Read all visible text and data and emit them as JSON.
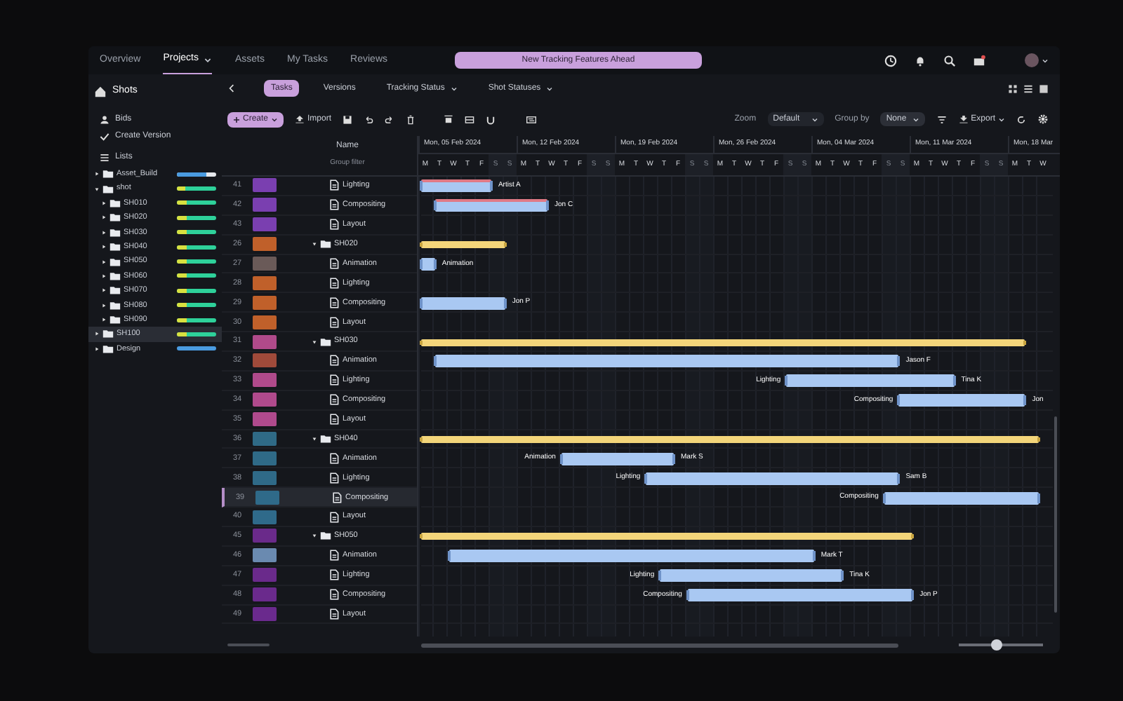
{
  "nav": {
    "items": [
      {
        "label": "Overview",
        "selected": false,
        "caret": false
      },
      {
        "label": "Projects",
        "selected": true,
        "caret": true
      },
      {
        "label": "Assets",
        "selected": false,
        "caret": false
      },
      {
        "label": "My Tasks",
        "selected": false,
        "caret": false
      },
      {
        "label": "Reviews",
        "selected": false,
        "caret": false
      }
    ],
    "banner": "New Tracking Features Ahead"
  },
  "sidebar": {
    "title": "Shots",
    "actions": [
      "Bids",
      "Create Version"
    ],
    "list_label": "Lists",
    "tree": [
      {
        "label": "Asset_Build",
        "level": 0.75,
        "kind": "plain",
        "selected": false,
        "expanded": false
      },
      {
        "label": "shot",
        "level": 0.2,
        "kind": "progress",
        "selected": false,
        "expanded": true,
        "children": [
          {
            "label": "SH010",
            "level": 0.25,
            "kind": "progress",
            "selected": false
          },
          {
            "label": "SH020",
            "level": 0.25,
            "kind": "progress",
            "selected": false
          },
          {
            "label": "SH030",
            "level": 0.25,
            "kind": "progress",
            "selected": false
          },
          {
            "label": "SH040",
            "level": 0.25,
            "kind": "progress",
            "selected": false
          },
          {
            "label": "SH050",
            "level": 0.25,
            "kind": "progress",
            "selected": false
          },
          {
            "label": "SH060",
            "level": 0.25,
            "kind": "progress",
            "selected": false
          },
          {
            "label": "SH070",
            "level": 0.25,
            "kind": "progress",
            "selected": false
          },
          {
            "label": "SH080",
            "level": 0.25,
            "kind": "progress",
            "selected": false
          },
          {
            "label": "SH090",
            "level": 0.25,
            "kind": "progress",
            "selected": false
          }
        ]
      },
      {
        "label": "SH100",
        "level": 0.25,
        "kind": "progress",
        "selected": true,
        "expanded": false
      },
      {
        "label": "Design",
        "level": 1,
        "kind": "plain",
        "selected": false,
        "expanded": false
      }
    ]
  },
  "tabs": [
    {
      "label": "Tasks",
      "selected": true,
      "caret": false
    },
    {
      "label": "Versions",
      "selected": false,
      "caret": false
    },
    {
      "label": "Tracking Status",
      "selected": false,
      "caret": true
    },
    {
      "label": "Shot Statuses",
      "selected": false,
      "caret": true
    }
  ],
  "toolbar": {
    "create": "Create",
    "import": "Import",
    "zoom_label": "Zoom",
    "zoom_value": "Default",
    "group_label": "Group by",
    "group_value": "None",
    "export": "Export"
  },
  "table": {
    "column": "Name",
    "filter": "Group filter",
    "rows": [
      {
        "num": "41",
        "kind": "task",
        "name": "Lighting",
        "color": "#7a3fb0",
        "selected": false,
        "late": true,
        "bar": {
          "from": {
            "level": 0
          },
          "to": {
            "level": 0.111
          }
        },
        "bar_right": "Artist A"
      },
      {
        "num": "42",
        "kind": "task",
        "name": "Compositing",
        "color": "#7a3fb0",
        "selected": false,
        "late": true,
        "bar": {
          "from": {
            "level": 0.022
          },
          "to": {
            "level": 0.2
          }
        },
        "bar_right": "Jon C"
      },
      {
        "num": "43",
        "kind": "task",
        "name": "Layout",
        "color": "#7a3fb0",
        "selected": false
      },
      {
        "num": "26",
        "kind": "folder",
        "name": "SH020",
        "color": "#c0602a",
        "selected": false,
        "late": false,
        "bar": {
          "from": {
            "level": 0
          },
          "to": {
            "level": 0.133
          }
        }
      },
      {
        "num": "27",
        "kind": "task",
        "name": "Animation",
        "color": "#6a5a58",
        "selected": false,
        "late": false,
        "bar": {
          "from": {
            "level": 0
          },
          "to": {
            "level": 0.022
          }
        },
        "bar_right": "Animation"
      },
      {
        "num": "28",
        "kind": "task",
        "name": "Lighting",
        "color": "#c0602a",
        "selected": false
      },
      {
        "num": "29",
        "kind": "task",
        "name": "Compositing",
        "color": "#c0602a",
        "selected": false,
        "late": false,
        "bar": {
          "from": {
            "level": 0
          },
          "to": {
            "level": 0.133
          }
        },
        "bar_right": "Jon P"
      },
      {
        "num": "30",
        "kind": "task",
        "name": "Layout",
        "color": "#c0602a",
        "selected": false
      },
      {
        "num": "31",
        "kind": "folder",
        "name": "SH030",
        "color": "#b04a8a",
        "selected": false,
        "late": false,
        "bar": {
          "from": {
            "level": 0
          },
          "to": {
            "level": 0.956
          }
        }
      },
      {
        "num": "32",
        "kind": "task",
        "name": "Animation",
        "color": "#a04a3a",
        "selected": false,
        "late": false,
        "bar": {
          "from": {
            "level": 0.022
          },
          "to": {
            "level": 0.756
          }
        },
        "bar_right": "Jason F"
      },
      {
        "num": "33",
        "kind": "task",
        "name": "Lighting",
        "color": "#b04a8b",
        "selected": false,
        "late": false,
        "bar": {
          "from": {
            "level": 0.578
          },
          "to": {
            "level": 0.844
          }
        },
        "bar_left": "Lighting",
        "bar_right": "Tina K"
      },
      {
        "num": "34",
        "kind": "task",
        "name": "Compositing",
        "color": "#b04a8c",
        "selected": false,
        "late": false,
        "bar": {
          "from": {
            "level": 0.756
          },
          "to": {
            "level": 0.956
          }
        },
        "bar_left": "Compositing",
        "bar_right": "Jon"
      },
      {
        "num": "35",
        "kind": "task",
        "name": "Layout",
        "color": "#b04a8d",
        "selected": false
      },
      {
        "num": "36",
        "kind": "folder",
        "name": "SH040",
        "color": "#2f6a86",
        "selected": false,
        "late": false,
        "bar": {
          "from": {
            "level": 0
          },
          "to": {
            "level": 0.978
          }
        }
      },
      {
        "num": "37",
        "kind": "task",
        "name": "Animation",
        "color": "#2f6a87",
        "selected": false,
        "late": false,
        "bar": {
          "from": {
            "level": 0.222
          },
          "to": {
            "level": 0.4
          }
        },
        "bar_left": "Animation",
        "bar_right": "Mark S"
      },
      {
        "num": "38",
        "kind": "task",
        "name": "Lighting",
        "color": "#2f6a88",
        "selected": false,
        "late": false,
        "bar": {
          "from": {
            "level": 0.356
          },
          "to": {
            "level": 0.756
          }
        },
        "bar_left": "Lighting",
        "bar_right": "Sam B"
      },
      {
        "num": "39",
        "kind": "task",
        "name": "Compositing",
        "color": "#2f6a89",
        "selected": true,
        "late": false,
        "bar": {
          "from": {
            "level": 0.733
          },
          "to": {
            "level": 0.978
          }
        },
        "bar_left": "Compositing"
      },
      {
        "num": "40",
        "kind": "task",
        "name": "Layout",
        "color": "#2f6a8a",
        "selected": false
      },
      {
        "num": "45",
        "kind": "folder",
        "name": "SH050",
        "color": "#6a2a8a",
        "selected": false,
        "late": false,
        "bar": {
          "from": {
            "level": 0
          },
          "to": {
            "level": 0.778
          }
        }
      },
      {
        "num": "46",
        "kind": "task",
        "name": "Animation",
        "color": "#6a8ab0",
        "selected": false,
        "late": false,
        "bar": {
          "from": {
            "level": 0.044
          },
          "to": {
            "level": 0.622
          }
        },
        "bar_right": "Mark T"
      },
      {
        "num": "47",
        "kind": "task",
        "name": "Lighting",
        "color": "#6a2a8b",
        "selected": false,
        "late": false,
        "bar": {
          "from": {
            "level": 0.378
          },
          "to": {
            "level": 0.667
          }
        },
        "bar_left": "Lighting",
        "bar_right": "Tina K"
      },
      {
        "num": "48",
        "kind": "task",
        "name": "Compositing",
        "color": "#6a2a8c",
        "selected": false,
        "late": false,
        "bar": {
          "from": {
            "level": 0.422
          },
          "to": {
            "level": 0.778
          }
        },
        "bar_left": "Compositing",
        "bar_right": "Jon P"
      },
      {
        "num": "49",
        "kind": "task",
        "name": "Layout",
        "color": "#6a2a8d",
        "selected": false
      }
    ]
  },
  "timeline": {
    "weeks": [
      "Mon, 05 Feb 2024",
      "Mon, 12 Feb 2024",
      "Mon, 19 Feb 2024",
      "Mon, 26 Feb 2024",
      "Mon, 04 Mar 2024",
      "Mon, 11 Mar 2024",
      "Mon, 18 Mar"
    ],
    "days": [
      {
        "d": "M",
        "weekend": false
      },
      {
        "d": "T",
        "weekend": false
      },
      {
        "d": "W",
        "weekend": false
      },
      {
        "d": "T",
        "weekend": false
      },
      {
        "d": "F",
        "weekend": false
      },
      {
        "d": "S",
        "weekend": true
      },
      {
        "d": "S",
        "weekend": true
      },
      {
        "d": "M",
        "weekend": false
      },
      {
        "d": "T",
        "weekend": false
      },
      {
        "d": "W",
        "weekend": false
      },
      {
        "d": "T",
        "weekend": false
      },
      {
        "d": "F",
        "weekend": false
      },
      {
        "d": "S",
        "weekend": true
      },
      {
        "d": "S",
        "weekend": true
      },
      {
        "d": "M",
        "weekend": false
      },
      {
        "d": "T",
        "weekend": false
      },
      {
        "d": "W",
        "weekend": false
      },
      {
        "d": "T",
        "weekend": false
      },
      {
        "d": "F",
        "weekend": false
      },
      {
        "d": "S",
        "weekend": true
      },
      {
        "d": "S",
        "weekend": true
      },
      {
        "d": "M",
        "weekend": false
      },
      {
        "d": "T",
        "weekend": false
      },
      {
        "d": "W",
        "weekend": false
      },
      {
        "d": "T",
        "weekend": false
      },
      {
        "d": "F",
        "weekend": false
      },
      {
        "d": "S",
        "weekend": true
      },
      {
        "d": "S",
        "weekend": true
      },
      {
        "d": "M",
        "weekend": false
      },
      {
        "d": "T",
        "weekend": false
      },
      {
        "d": "W",
        "weekend": false
      },
      {
        "d": "T",
        "weekend": false
      },
      {
        "d": "F",
        "weekend": false
      },
      {
        "d": "S",
        "weekend": true
      },
      {
        "d": "S",
        "weekend": true
      },
      {
        "d": "M",
        "weekend": false
      },
      {
        "d": "T",
        "weekend": false
      },
      {
        "d": "W",
        "weekend": false
      },
      {
        "d": "T",
        "weekend": false
      },
      {
        "d": "F",
        "weekend": false
      },
      {
        "d": "S",
        "weekend": true
      },
      {
        "d": "S",
        "weekend": true
      },
      {
        "d": "M",
        "weekend": false
      },
      {
        "d": "T",
        "weekend": false
      },
      {
        "d": "W",
        "weekend": false
      }
    ],
    "zoom": {
      "level": 0.45
    }
  }
}
